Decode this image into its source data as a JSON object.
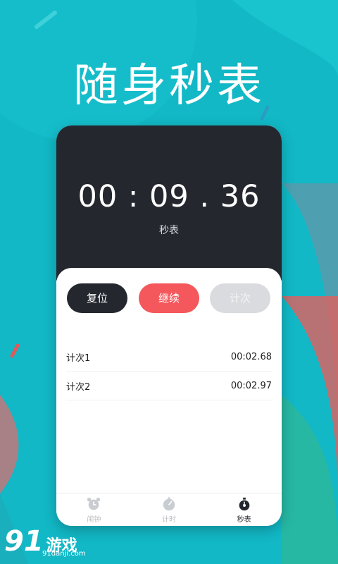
{
  "headline": "随身秒表",
  "timer": {
    "display": "00 : 09 . 36",
    "label": "秒表"
  },
  "buttons": {
    "reset": "复位",
    "resume": "继续",
    "lap": "计次"
  },
  "laps": [
    {
      "name": "计次1",
      "time": "00:02.68"
    },
    {
      "name": "计次2",
      "time": "00:02.97"
    }
  ],
  "tabs": [
    {
      "label": "闹钟",
      "icon": "alarm-clock-icon",
      "active": false
    },
    {
      "label": "计时",
      "icon": "timer-icon",
      "active": false
    },
    {
      "label": "秒表",
      "icon": "stopwatch-icon",
      "active": true
    }
  ],
  "watermark": {
    "number": "91",
    "text": "游戏",
    "url": "91danji.com"
  },
  "colors": {
    "background": "#12b8c6",
    "dark": "#24272e",
    "accent_red": "#f4585c",
    "disabled_gray": "#d9dbde"
  }
}
